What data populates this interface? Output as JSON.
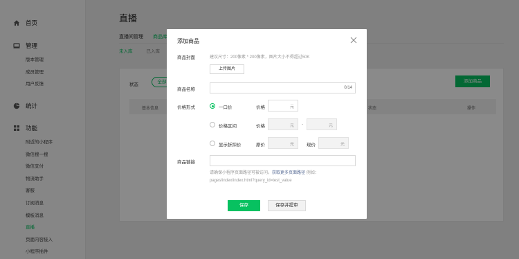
{
  "sidebar": {
    "home": "首页",
    "manage": {
      "title": "管理",
      "items": [
        "版本管理",
        "成员管理",
        "用户反馈"
      ]
    },
    "stats": "统计",
    "features": {
      "title": "功能",
      "items": [
        "附近的小程序",
        "微信搜一搜",
        "微信支付",
        "物流助手",
        "客服",
        "订阅消息",
        "模板消息",
        "直播",
        "页面内容接入",
        "小程序插件"
      ],
      "active": "直播"
    }
  },
  "main": {
    "title": "直播",
    "tabs": [
      "直播间管理",
      "商品库"
    ],
    "subtabs": [
      "未入库",
      "已入库"
    ],
    "filter": {
      "status_label": "状态",
      "status_value": "全部"
    },
    "add_button": "添加商品",
    "table_headers": [
      "基本信息",
      "状态",
      "操作"
    ]
  },
  "dialog": {
    "title": "添加商品",
    "cover": {
      "label": "商品封面",
      "hint": "建议尺寸：200像素 * 200像素，图片大小不得超过50K",
      "upload": "上传图片"
    },
    "name": {
      "label": "商品名称",
      "counter": "0/14"
    },
    "price": {
      "label": "价格形式",
      "options": [
        {
          "label": "一口价",
          "field1": "价格",
          "unit": "元",
          "selected": true
        },
        {
          "label": "价格区间",
          "field1": "价格",
          "unit": "元",
          "dash": "-"
        },
        {
          "label": "显示折扣价",
          "field1": "原价",
          "field2": "现价",
          "unit": "元"
        }
      ]
    },
    "link": {
      "label": "商品链接",
      "hint_prefix": "请确保小程序页面路径可被访问。",
      "hint_link": "获取更多页面路径",
      "hint_suffix": " 例如：pages/index/index.html?query_id=test_value"
    },
    "save": "保存",
    "save_audit": "保存并提审"
  },
  "colors": {
    "accent": "#07c160",
    "link": "#576b95",
    "overlay": "rgba(0,0,0,0.46)"
  }
}
